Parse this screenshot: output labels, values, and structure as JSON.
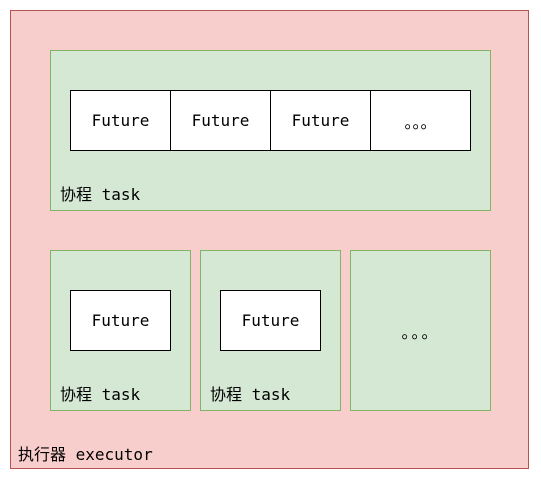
{
  "executor": {
    "label": "执行器 executor"
  },
  "task_top": {
    "label": "协程 task",
    "futures": [
      "Future",
      "Future",
      "Future"
    ],
    "more": "。。。"
  },
  "task_bottom_1": {
    "label": "协程 task",
    "future": "Future"
  },
  "task_bottom_2": {
    "label": "协程 task",
    "future": "Future"
  },
  "task_bottom_more": {
    "more": "。。。"
  }
}
